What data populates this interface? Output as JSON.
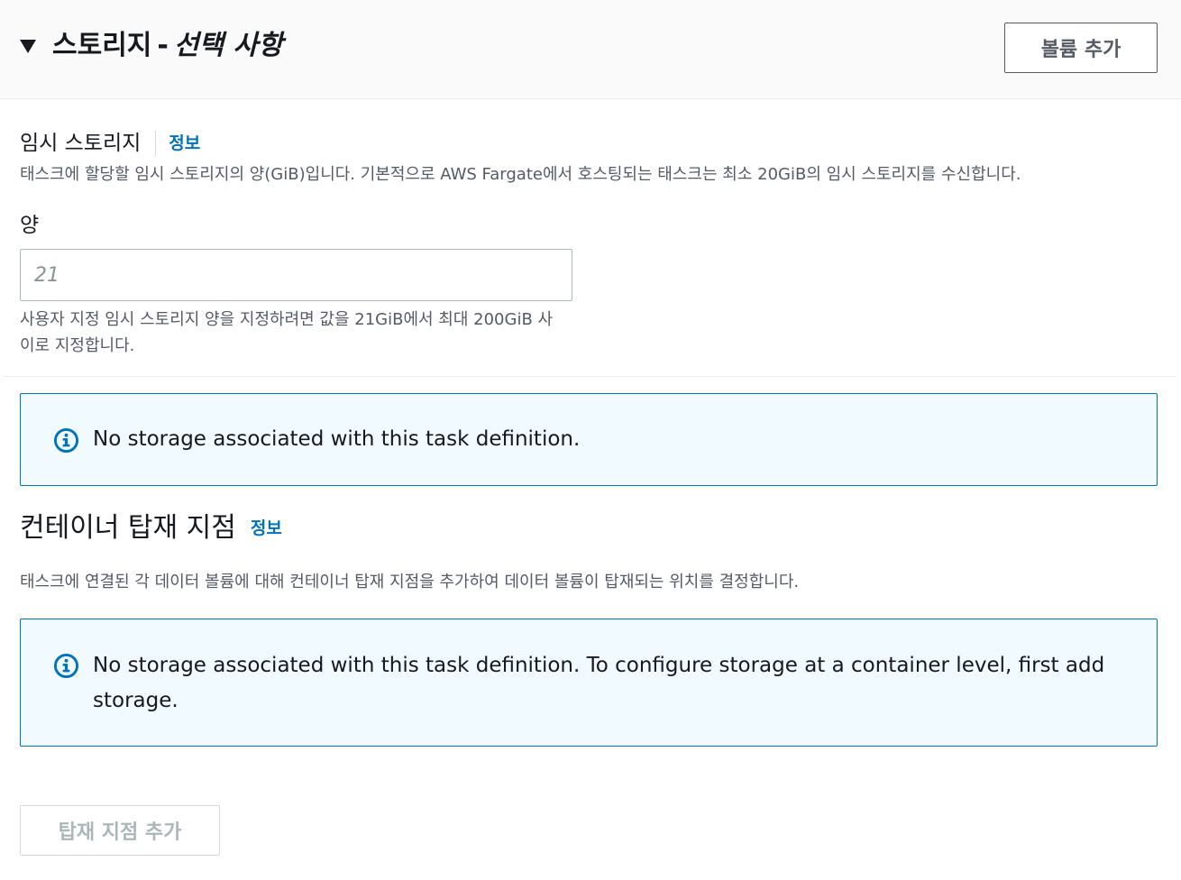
{
  "header": {
    "title_main": "스토리지",
    "title_sep": "-",
    "title_optional": "선택 사항",
    "add_volume_button": "볼륨 추가"
  },
  "ephemeral_storage": {
    "label": "임시 스토리지",
    "info_link": "정보",
    "description": "태스크에 할당할 임시 스토리지의 양(GiB)입니다. 기본적으로 AWS Fargate에서 호스팅되는 태스크는 최소 20GiB의 임시 스토리지를 수신합니다.",
    "amount_label": "양",
    "amount_placeholder": "21",
    "amount_value": "",
    "constraint_text": "사용자 지정 임시 스토리지 양을 지정하려면 값을 21GiB에서 최대 200GiB 사이로 지정합니다."
  },
  "volumes_alert": {
    "icon": "info-icon",
    "text": "No storage associated with this task definition."
  },
  "mount_points": {
    "title": "컨테이너 탑재 지점",
    "info_link": "정보",
    "description": "태스크에 연결된 각 데이터 볼륨에 대해 컨테이너 탑재 지점을 추가하여 데이터 볼륨이 탑재되는 위치를 결정합니다.",
    "alert": {
      "icon": "info-icon",
      "text": "No storage associated with this task definition. To configure storage at a container level, first add storage."
    },
    "add_button": "탑재 지점 추가",
    "add_button_disabled": true
  },
  "colors": {
    "info_blue": "#0073bb",
    "alert_background": "#f1faff",
    "header_background": "#fafafa",
    "secondary_text": "#545b64",
    "disabled_text": "#aab7b8"
  }
}
